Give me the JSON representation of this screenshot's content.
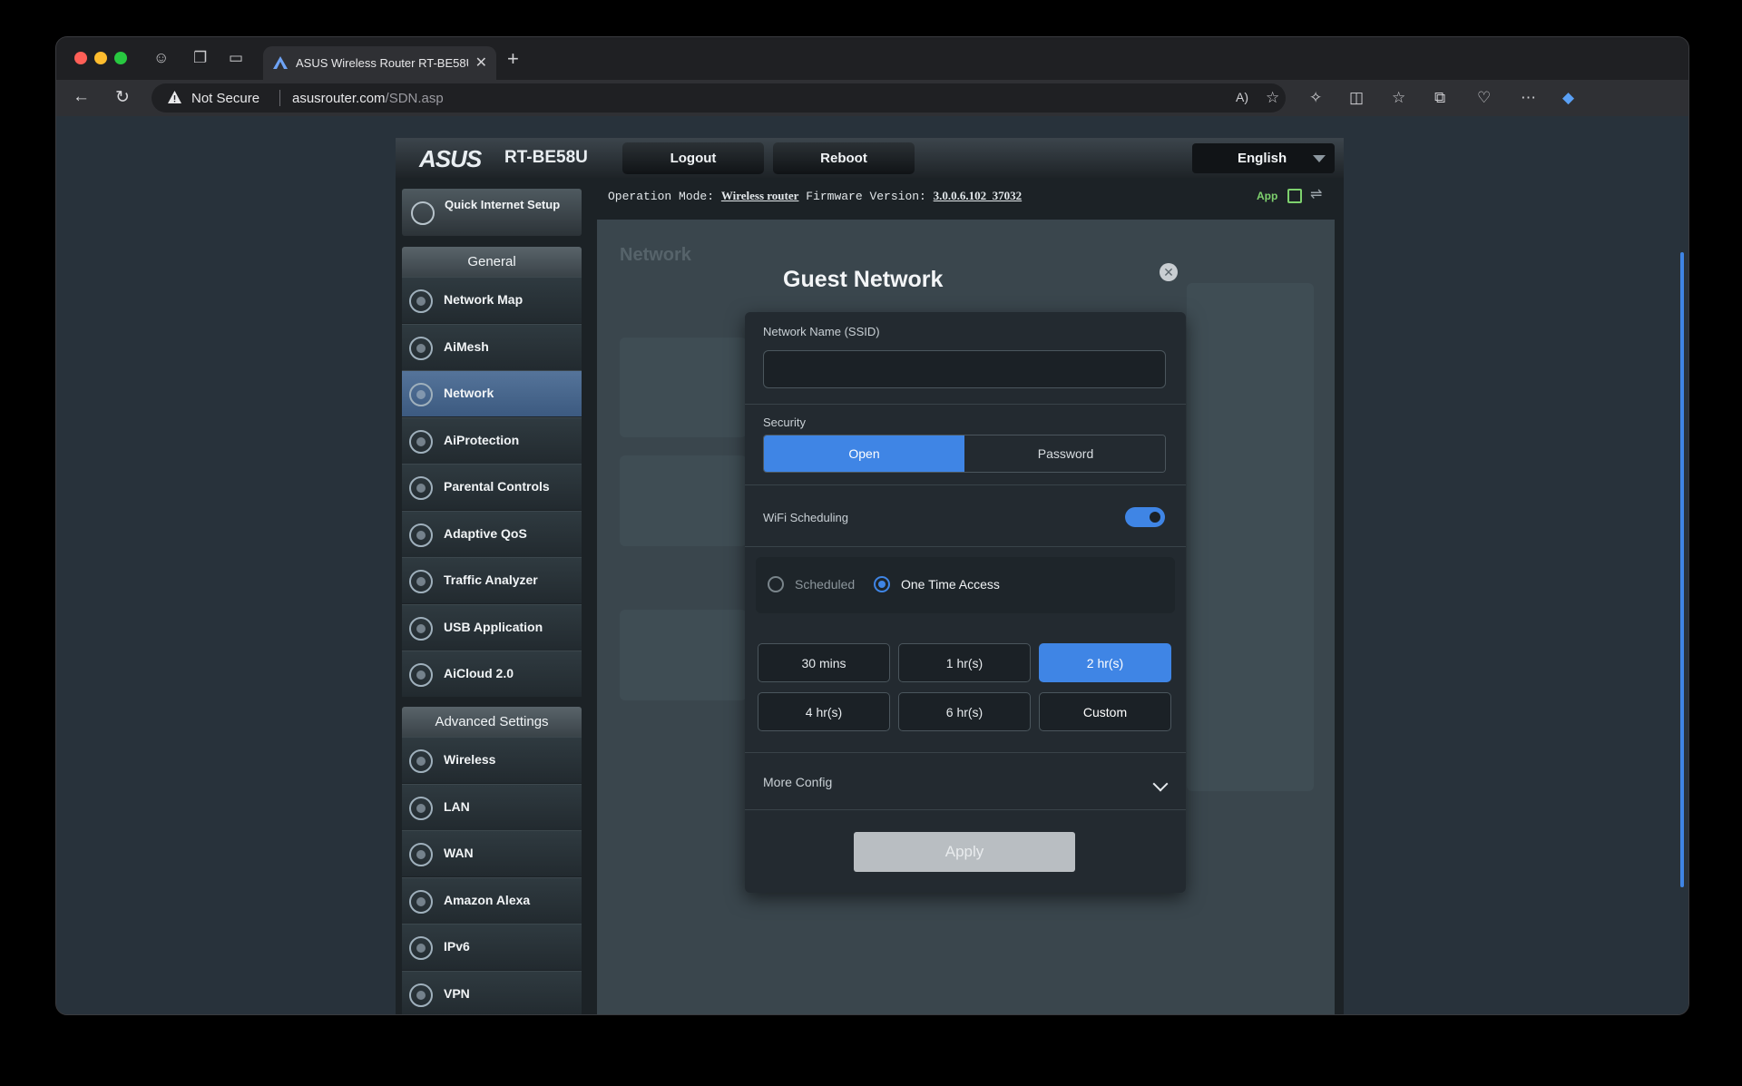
{
  "browser": {
    "tab_title": "ASUS Wireless Router RT-BE58U - SDN",
    "security_label": "Not Secure",
    "url_host": "asusrouter.com",
    "url_path": "/SDN.asp"
  },
  "router": {
    "brand": "ASUS",
    "model": "RT-BE58U",
    "logout": "Logout",
    "reboot": "Reboot",
    "language": "English",
    "op_mode_label": "Operation Mode:",
    "op_mode_value": "Wireless router",
    "firmware_label": "Firmware Version:",
    "firmware_value": "3.0.0.6.102_37032",
    "app_label": "App"
  },
  "sidebar": {
    "quick_setup": "Quick Internet Setup",
    "general_header": "General",
    "general_items": [
      {
        "label": "Network Map",
        "icon": "globe-icon"
      },
      {
        "label": "AiMesh",
        "icon": "mesh-icon"
      },
      {
        "label": "Network",
        "icon": "network-globe-icon"
      },
      {
        "label": "AiProtection",
        "icon": "shield-icon"
      },
      {
        "label": "Parental Controls",
        "icon": "family-icon"
      },
      {
        "label": "Adaptive QoS",
        "icon": "gauge-icon"
      },
      {
        "label": "Traffic Analyzer",
        "icon": "chart-icon"
      },
      {
        "label": "USB Application",
        "icon": "usb-icon"
      },
      {
        "label": "AiCloud 2.0",
        "icon": "cloud-icon"
      }
    ],
    "advanced_header": "Advanced Settings",
    "advanced_items": [
      {
        "label": "Wireless",
        "icon": "wifi-icon"
      },
      {
        "label": "LAN",
        "icon": "monitor-icon"
      },
      {
        "label": "WAN",
        "icon": "globe-icon"
      },
      {
        "label": "Amazon Alexa",
        "icon": "alexa-icon"
      },
      {
        "label": "IPv6",
        "icon": "ipv6-icon"
      },
      {
        "label": "VPN",
        "icon": "vpn-icon"
      }
    ]
  },
  "content": {
    "page_title": "Network"
  },
  "modal": {
    "title": "Guest Network",
    "ssid_label": "Network Name (SSID)",
    "ssid_value": "",
    "security_label": "Security",
    "security_open": "Open",
    "security_password": "Password",
    "wifi_scheduling_label": "WiFi Scheduling",
    "radio_scheduled": "Scheduled",
    "radio_one_time": "One Time Access",
    "durations": [
      "30 mins",
      "1 hr(s)",
      "2 hr(s)",
      "4 hr(s)",
      "6 hr(s)",
      "Custom"
    ],
    "more_config": "More Config",
    "apply": "Apply"
  },
  "colors": {
    "accent": "#3f85e5",
    "active_nav": "#4a6a92"
  }
}
